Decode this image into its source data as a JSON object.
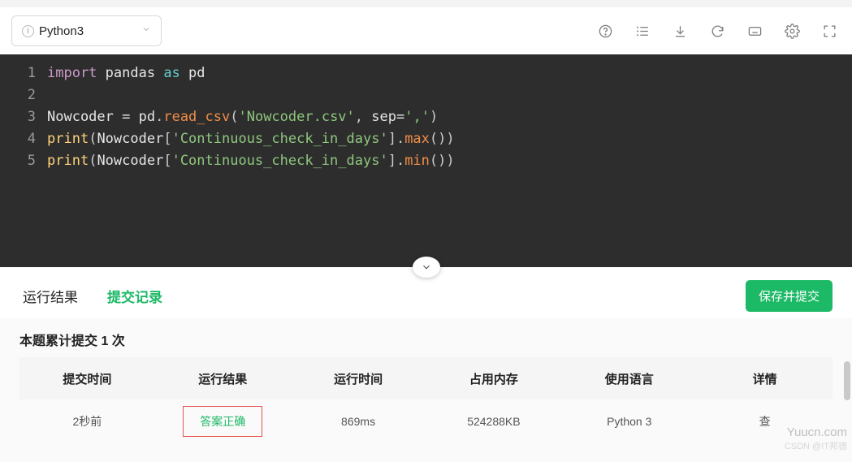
{
  "toolbar": {
    "language": "Python3"
  },
  "code": {
    "lines": [
      {
        "n": "1",
        "tokens": [
          {
            "c": "t-kw",
            "t": "import"
          },
          {
            "c": "t-id",
            "t": " pandas "
          },
          {
            "c": "t-kw2",
            "t": "as"
          },
          {
            "c": "t-id",
            "t": " pd"
          }
        ]
      },
      {
        "n": "2",
        "tokens": []
      },
      {
        "n": "3",
        "tokens": [
          {
            "c": "t-id",
            "t": "Nowcoder "
          },
          {
            "c": "t-op",
            "t": "="
          },
          {
            "c": "t-id",
            "t": " pd"
          },
          {
            "c": "t-pn",
            "t": "."
          },
          {
            "c": "t-fn",
            "t": "read_csv"
          },
          {
            "c": "t-pn",
            "t": "("
          },
          {
            "c": "t-str",
            "t": "'Nowcoder.csv'"
          },
          {
            "c": "t-pn",
            "t": ", "
          },
          {
            "c": "t-id",
            "t": "sep"
          },
          {
            "c": "t-op",
            "t": "="
          },
          {
            "c": "t-str",
            "t": "','"
          },
          {
            "c": "t-pn",
            "t": ")"
          }
        ]
      },
      {
        "n": "4",
        "tokens": [
          {
            "c": "t-def",
            "t": "print"
          },
          {
            "c": "t-pn",
            "t": "("
          },
          {
            "c": "t-id",
            "t": "Nowcoder"
          },
          {
            "c": "t-pn",
            "t": "["
          },
          {
            "c": "t-str",
            "t": "'Continuous_check_in_days'"
          },
          {
            "c": "t-pn",
            "t": "]"
          },
          {
            "c": "t-pn",
            "t": "."
          },
          {
            "c": "t-fn",
            "t": "max"
          },
          {
            "c": "t-pn",
            "t": "())"
          }
        ]
      },
      {
        "n": "5",
        "tokens": [
          {
            "c": "t-def",
            "t": "print"
          },
          {
            "c": "t-pn",
            "t": "("
          },
          {
            "c": "t-id",
            "t": "Nowcoder"
          },
          {
            "c": "t-pn",
            "t": "["
          },
          {
            "c": "t-str",
            "t": "'Continuous_check_in_days'"
          },
          {
            "c": "t-pn",
            "t": "]"
          },
          {
            "c": "t-pn",
            "t": "."
          },
          {
            "c": "t-fn",
            "t": "min"
          },
          {
            "c": "t-pn",
            "t": "())"
          }
        ]
      }
    ]
  },
  "tabs": {
    "run_result": "运行结果",
    "submit_log": "提交记录",
    "submit_button": "保存并提交"
  },
  "summary": "本题累计提交 1 次",
  "table": {
    "headers": [
      "提交时间",
      "运行结果",
      "运行时间",
      "占用内存",
      "使用语言",
      "详情"
    ],
    "row": {
      "time": "2秒前",
      "status": "答案正确",
      "runtime": "869ms",
      "memory": "524288KB",
      "language": "Python 3",
      "detail": "查"
    }
  },
  "watermark": {
    "line1": "Yuucn.com",
    "line2": "CSDN @IT邦德"
  }
}
